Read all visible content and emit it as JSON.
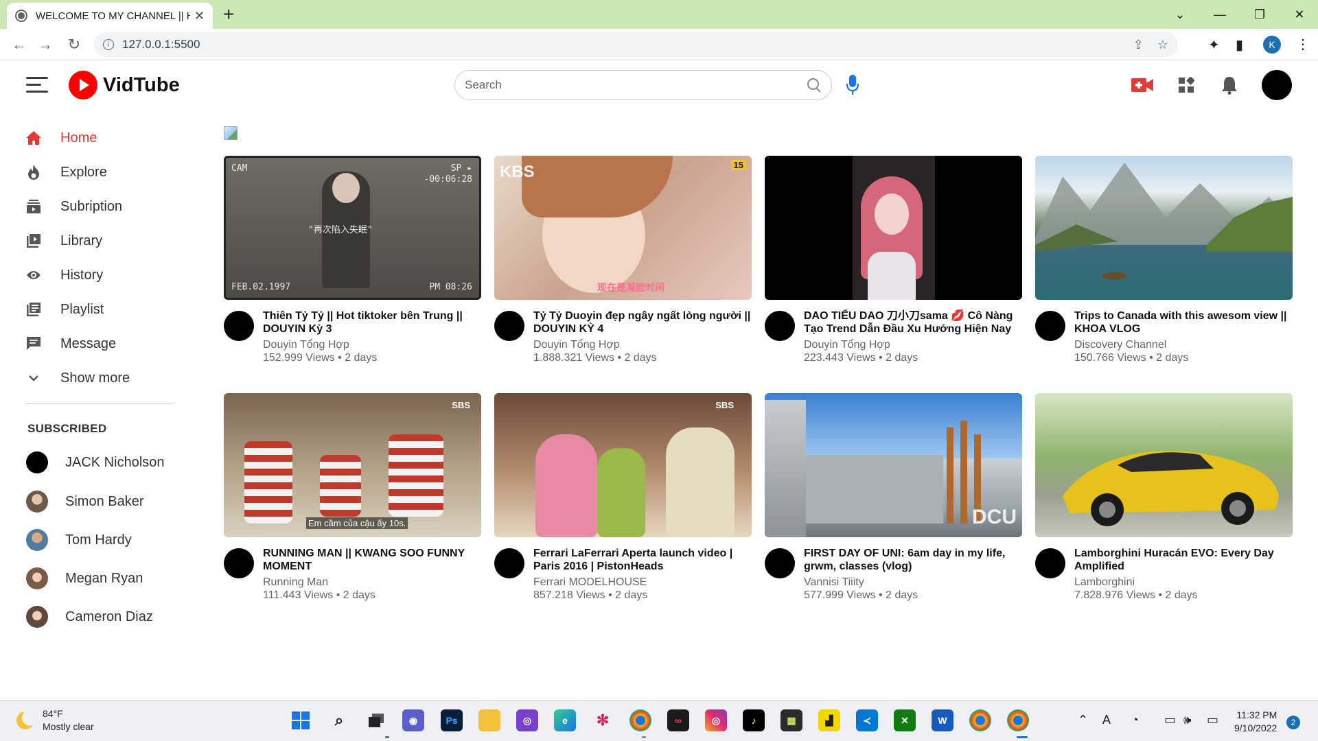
{
  "browser": {
    "tab_title": "WELCOME TO MY CHANNEL || H",
    "tab_close": "✕",
    "new_tab": "+",
    "url": "127.0.0.1:5500",
    "profile_initial": "K"
  },
  "app": {
    "logo_text": "VidTube",
    "search_placeholder": "Search"
  },
  "sidebar": {
    "items": [
      {
        "label": "Home",
        "icon": "home-icon",
        "active": true
      },
      {
        "label": "Explore",
        "icon": "flame-icon"
      },
      {
        "label": "Subription",
        "icon": "subscriptions-icon"
      },
      {
        "label": "Library",
        "icon": "library-icon"
      },
      {
        "label": "History",
        "icon": "eye-icon"
      },
      {
        "label": "Playlist",
        "icon": "playlist-icon"
      },
      {
        "label": "Message",
        "icon": "message-icon"
      },
      {
        "label": "Show more",
        "icon": "chevron-down-icon"
      }
    ],
    "subscribed_heading": "SUBSCRIBED",
    "subscriptions": [
      {
        "name": "JACK Nicholson",
        "color": "#000000"
      },
      {
        "name": "Simon Baker",
        "color": "#8a7a6a"
      },
      {
        "name": "Tom Hardy",
        "color": "#6e8aa0"
      },
      {
        "name": "Megan Ryan",
        "color": "#b98f78"
      },
      {
        "name": "Cameron Diaz",
        "color": "#a08a70"
      }
    ]
  },
  "videos": [
    {
      "title": "Thiên Tỷ Tỷ || Hot tiktoker bên Trung || DOUYIN Kỳ 3",
      "channel": "Douyin Tổng Hợp",
      "stats": "152.999 Views • 2 days",
      "overlay": {
        "cam": "CAM",
        "sp": "SP ▸",
        "time": "-00:06:28",
        "date": "FEB.02.1997",
        "clock": "PM 08:26",
        "caption": "\"再次陷入失眠\""
      }
    },
    {
      "title": "Tỷ Tỷ Duoyin đẹp ngây ngất lòng người || DOUYIN KỲ 4",
      "channel": "Douyin Tổng Hợp",
      "stats": "1.888.321 Views • 2 days",
      "overlay": {
        "logo": "KBS",
        "rating": "15",
        "caption": "现在是凝脸时间"
      }
    },
    {
      "title": "DAO TIỂU DAO 刀小刀sama 💋 Cô Nàng Tạo Trend Dẫn Đầu Xu Hướng Hiện Nay",
      "channel": "Douyin Tổng Hợp",
      "stats": "223.443 Views • 2 days"
    },
    {
      "title": "Trips to Canada with this awesom view || KHOA VLOG",
      "channel": "Discovery Channel",
      "stats": "150.766 Views • 2 days"
    },
    {
      "title": "RUNNING MAN || KWANG SOO FUNNY MOMENT",
      "channel": "Running Man",
      "stats": "111.443 Views • 2 days",
      "overlay": {
        "logo": "SBS",
        "subtitle": "Em cầm của cậu ấy 10s."
      }
    },
    {
      "title": "Ferrari LaFerrari Aperta launch video | Paris 2016 | PistonHeads",
      "channel": "Ferrari MODELHOUSE",
      "stats": "857.218 Views • 2 days",
      "overlay": {
        "logo": "SBS"
      }
    },
    {
      "title": "FIRST DAY OF UNI: 6am day in my life, grwm, classes (vlog)",
      "channel": "Vannisi Tiiity",
      "stats": "577.999 Views • 2 days",
      "overlay": {
        "sign": "DCU"
      }
    },
    {
      "title": "Lamborghini Huracán EVO: Every Day Amplified",
      "channel": "Lamborghini",
      "stats": "7.828.976 Views • 2 days"
    }
  ],
  "taskbar": {
    "temperature": "84°F",
    "condition": "Mostly clear",
    "time": "11:32 PM",
    "date": "9/10/2022",
    "notifications": "2"
  },
  "colors": {
    "accent": "#ff0000",
    "active_nav": "#e53935",
    "tab_strip": "#cce8b5"
  }
}
